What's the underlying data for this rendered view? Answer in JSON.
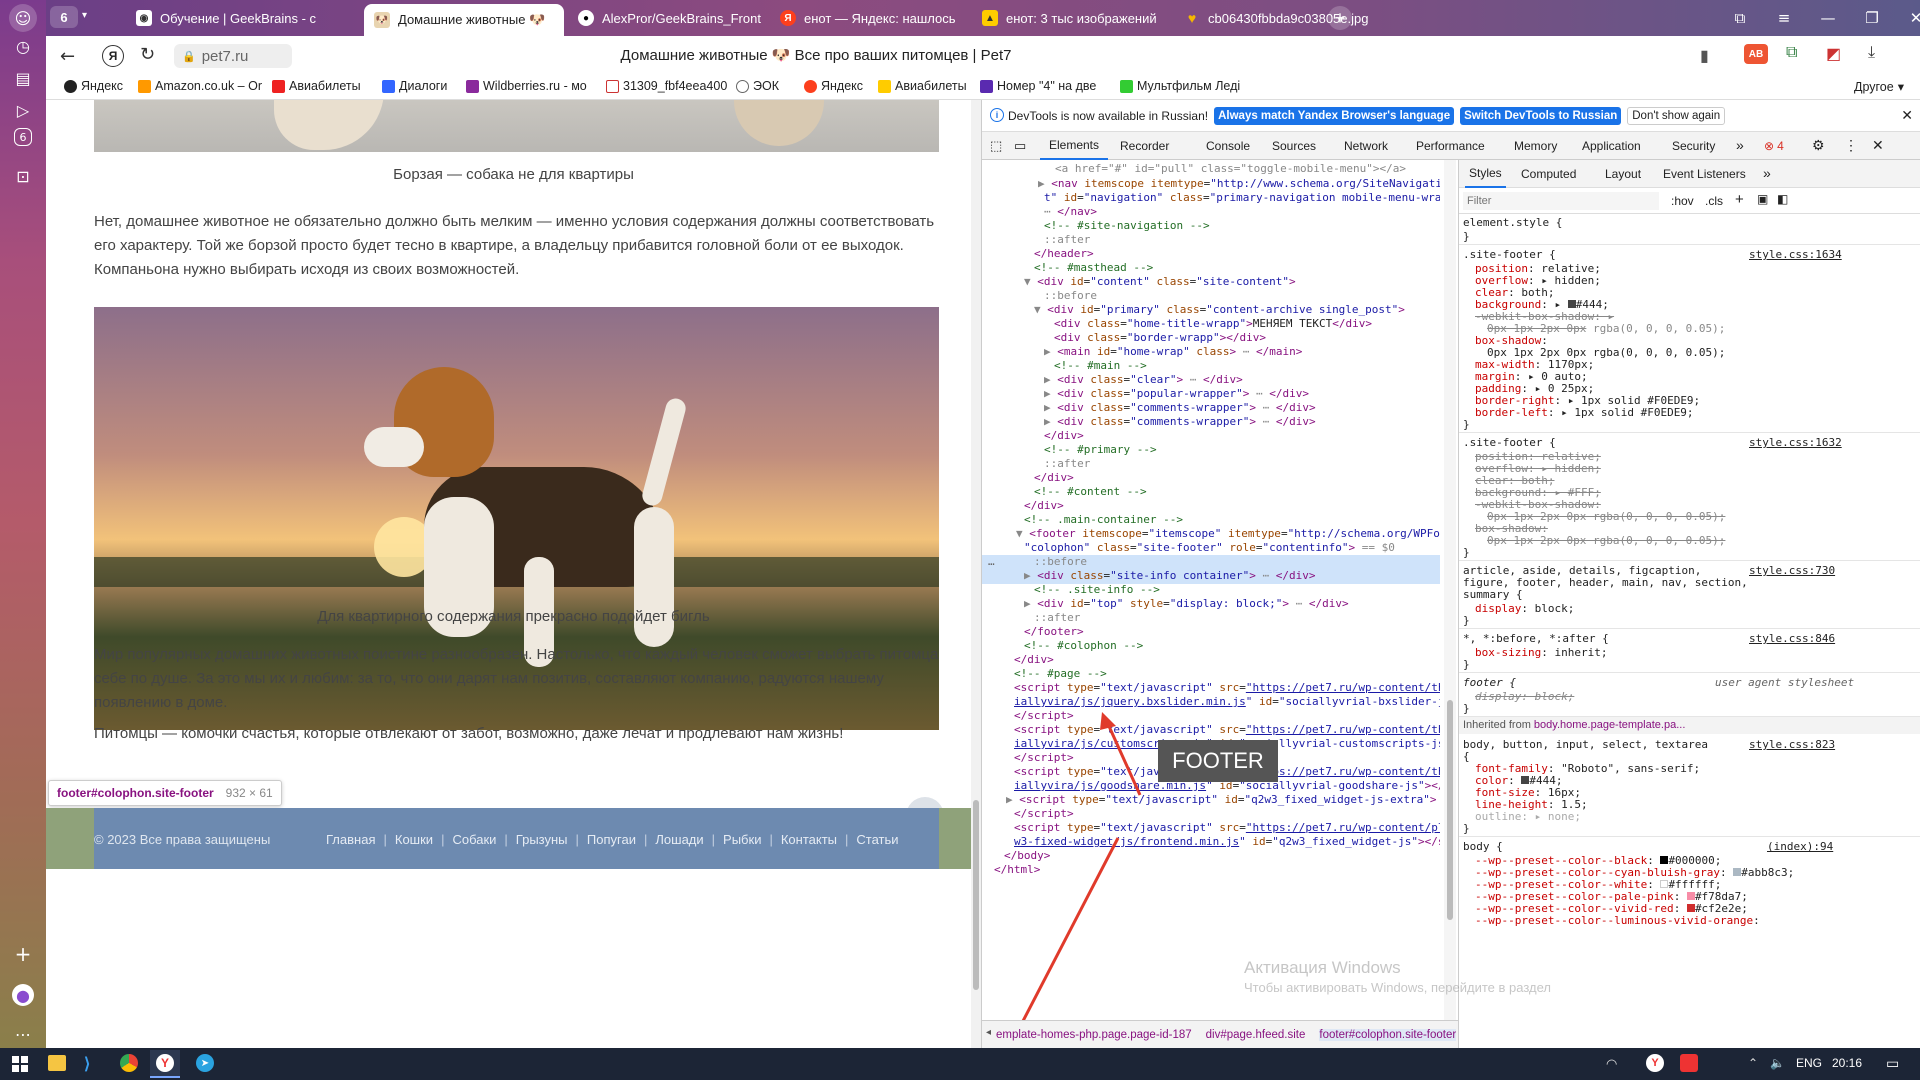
{
  "tabs": {
    "counter": "6",
    "items": [
      {
        "label": "Обучение | GeekBrains - с",
        "icon": "geekbrains-icon"
      },
      {
        "label": "Домашние животные 🐶 ",
        "icon": "pet7-icon"
      },
      {
        "label": "AlexPror/GeekBrains_Front",
        "icon": "github-icon"
      },
      {
        "label": "енот — Яндекс: нашлось",
        "icon": "yandex-icon"
      },
      {
        "label": "енот: 3 тыс изображений",
        "icon": "images-icon"
      },
      {
        "label": "cb06430fbbda9c03805e.jpg",
        "icon": "heart-icon"
      }
    ]
  },
  "address": {
    "url": "pet7.ru",
    "title": "Домашние животные 🐶 Все про ваших питомцев | Pet7"
  },
  "bookmarks": [
    "Яндекс",
    "Amazon.co.uk – Or",
    "Авиабилеты",
    "Диалоги",
    "Wildberries.ru - мо",
    "31309_fbf4eea400",
    "ЭОК",
    "Яндекс",
    "Авиабилеты",
    "Номер \"4\" на две",
    "Мультфильм Леді",
    "Другое"
  ],
  "page": {
    "caption1": "Борзая — собака не для квартиры",
    "para1": "Нет, домашнее животное не обязательно должно быть мелким — именно условия содержания должны соответствовать его характеру. Той же борзой просто будет тесно в квартире, а владельцу прибавится головной боли от ее выходок. Компаньона нужно выбирать исходя из своих возможностей.",
    "caption2": "Для квартирного содержания прекрасно подойдет бигль",
    "para2": "Мир популярных домашних животных поистине разнообразен. Настолько, что каждый человек сможет выбрать питомца себе по душе. За это мы их и любим: за то, что они дарят нам позитив, составляют компанию, радуются нашему появлению в доме.",
    "para3": "Питомцы — комочки счастья, которые отвлекают от забот, возможно, даже лечат и продлевают нам жизнь!",
    "tooltip_selector": "footer#colophon.site-footer",
    "tooltip_size": "932 × 61",
    "footer_copyright": "© 2023 Все права защищены",
    "footer_links": [
      "Главная",
      "Кошки",
      "Собаки",
      "Грызуны",
      "Попугаи",
      "Лошади",
      "Рыбки",
      "Контакты",
      "Статьи"
    ]
  },
  "devtools": {
    "banner_text": "DevTools is now available in Russian!",
    "banner_btn1": "Always match Yandex Browser's language",
    "banner_btn2": "Switch DevTools to Russian",
    "banner_btn3": "Don't show again",
    "tabs": [
      "Elements",
      "Recorder",
      "Console",
      "Sources",
      "Network",
      "Performance",
      "Memory",
      "Application",
      "Security"
    ],
    "error_count": "4",
    "styles_tabs": [
      "Styles",
      "Computed",
      "Layout",
      "Event Listeners"
    ],
    "filter_placeholder": "Filter",
    "hov": ":hov",
    "cls": ".cls",
    "annotation": "FOOTER",
    "breadcrumbs": [
      "emplate-homes-php.page.page-id-187",
      "div#page.hfeed.site",
      "footer#colophon.site-footer"
    ],
    "watermark1": "Активация Windows",
    "watermark2": "Чтобы активировать Windows, перейдите в раздел"
  },
  "taskbar": {
    "lang": "ENG",
    "time": "20:16"
  }
}
